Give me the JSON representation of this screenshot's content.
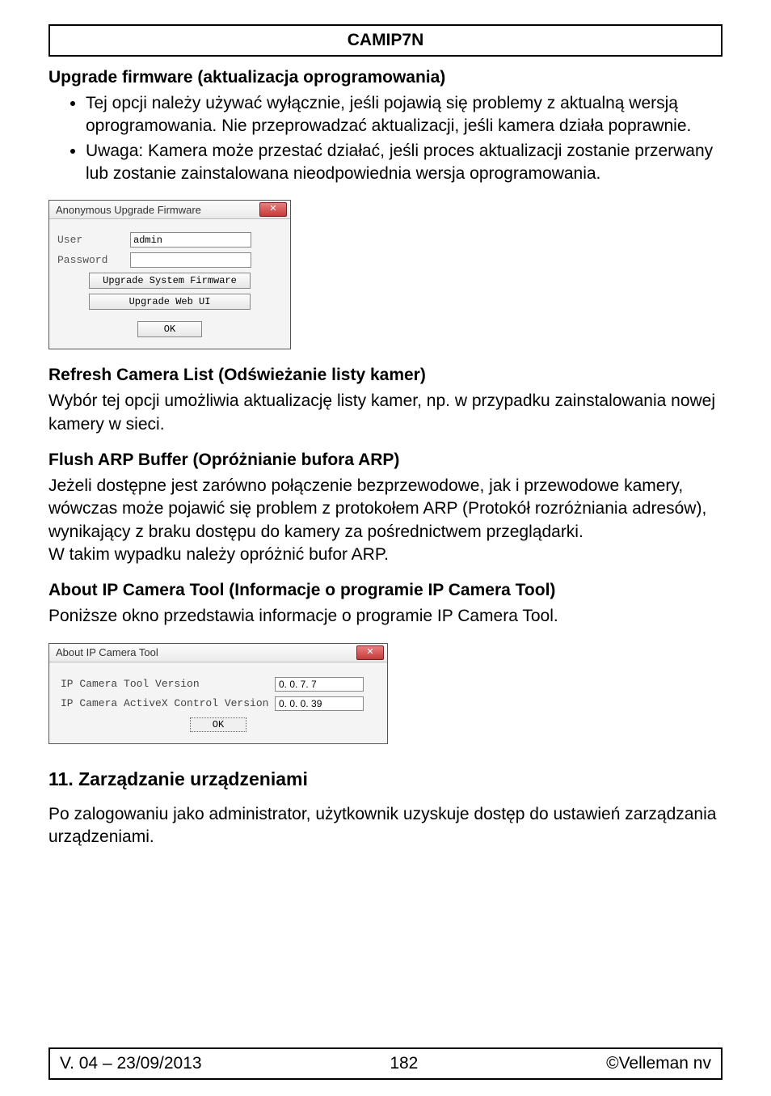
{
  "header": {
    "title": "CAMIP7N"
  },
  "sections": {
    "upgrade": {
      "heading": "Upgrade firmware (aktualizacja oprogramowania)",
      "bullets": [
        "Tej opcji należy używać wyłącznie, jeśli pojawią się problemy z aktualną wersją oprogramowania. Nie przeprowadzać aktualizacji, jeśli kamera działa poprawnie.",
        "Uwaga: Kamera może przestać działać, jeśli proces aktualizacji zostanie przerwany lub zostanie zainstalowana nieodpowiednia wersja oprogramowania."
      ]
    },
    "refresh": {
      "heading": "Refresh Camera List (Odświeżanie listy kamer)",
      "body": "Wybór tej opcji umożliwia aktualizację listy kamer, np. w przypadku zainstalowania nowej kamery w sieci."
    },
    "flush": {
      "heading": "Flush ARP Buffer (Opróżnianie bufora ARP)",
      "body": "Jeżeli dostępne jest zarówno połączenie bezprzewodowe, jak i przewodowe kamery, wówczas może pojawić się problem z protokołem ARP (Protokół rozróżniania adresów), wynikający z braku dostępu do kamery za pośrednictwem przeglądarki.\nW takim wypadku należy opróżnić bufor ARP."
    },
    "about": {
      "heading": "About IP Camera Tool (Informacje o programie IP Camera Tool)",
      "body": "Poniższe okno przedstawia informacje o programie IP Camera Tool."
    },
    "chapter": {
      "heading": "11. Zarządzanie urządzeniami",
      "body": "Po zalogowaniu jako administrator, użytkownik uzyskuje dostęp do ustawień zarządzania urządzeniami."
    }
  },
  "dialog_upgrade": {
    "title": "Anonymous Upgrade Firmware",
    "close_glyph": "✕",
    "user_label": "User",
    "user_value": "admin",
    "password_label": "Password",
    "password_value": "",
    "btn_sys": "Upgrade System Firmware",
    "btn_web": "Upgrade Web UI",
    "btn_ok": "OK"
  },
  "dialog_about": {
    "title": "About IP Camera Tool",
    "close_glyph": "✕",
    "row1_label": "IP Camera Tool Version",
    "row1_value": "0. 0. 7. 7",
    "row2_label": "IP Camera ActiveX Control Version",
    "row2_value": "0. 0. 0. 39",
    "btn_ok": "OK"
  },
  "footer": {
    "left": "V. 04 – 23/09/2013",
    "center": "182",
    "right": "©Velleman nv"
  }
}
